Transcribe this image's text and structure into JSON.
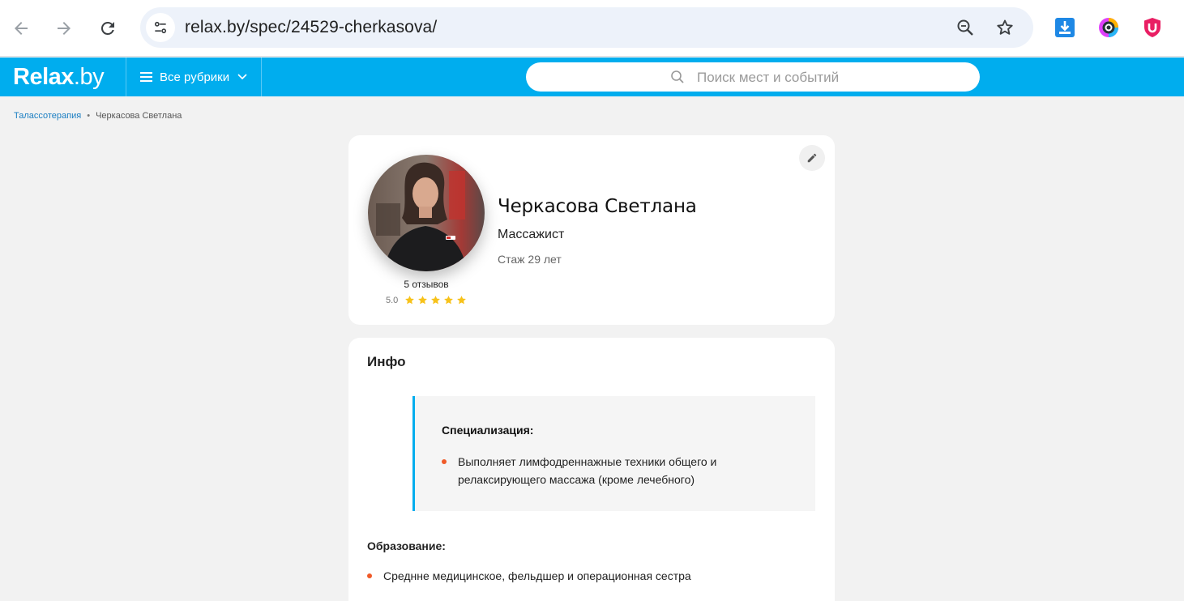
{
  "browser": {
    "url": "relax.by/spec/24529-cherkasova/",
    "icons": [
      "back-arrow-icon",
      "forward-arrow-icon",
      "reload-icon",
      "site-info-icon",
      "zoom-icon",
      "bookmark-star-icon",
      "download-extension-icon",
      "camera-extension-icon",
      "shield-extension-icon"
    ]
  },
  "header": {
    "logo_bold": "Relax",
    "logo_light": ".by",
    "rubrics_label": "Все рубрики",
    "search_placeholder": "Поиск мест и событий",
    "brand_color": "#00adee"
  },
  "breadcrumb": {
    "link": "Талассотерапия",
    "separator": "•",
    "current": "Черкасова Светлана"
  },
  "profile": {
    "name": "Черкасова Светлана",
    "profession": "Массажист",
    "experience": "Стаж 29 лет",
    "reviews": "5 отзывов",
    "rating": "5.0",
    "stars": 5
  },
  "info": {
    "title": "Инфо",
    "specialization_title": "Специализация:",
    "specialization_text": "Выполняет лимфодреннажные техники общего и релаксирующего массажа (кроме лечебного)",
    "education_title": "Образование:",
    "education_text": "Среднне медицинское, фельдшер и операционная сестра",
    "bullet_color": "#f05a28"
  }
}
